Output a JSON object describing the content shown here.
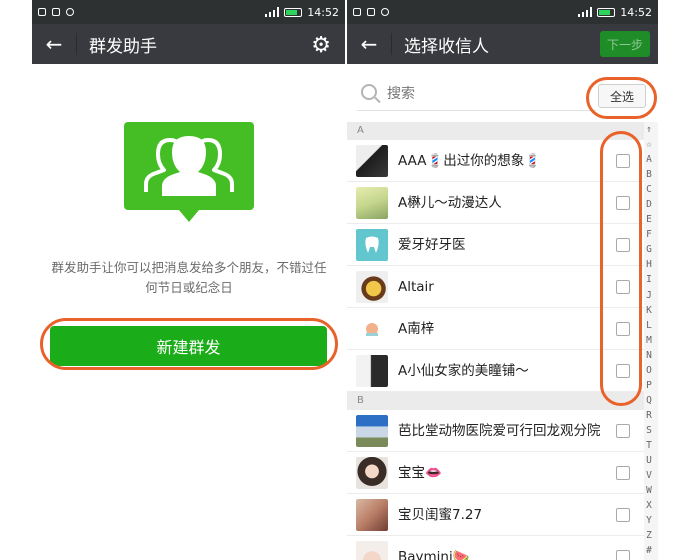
{
  "status_bar": {
    "time": "14:52"
  },
  "left": {
    "title": "群发助手",
    "description": "群发助手让你可以把消息发给多个朋友，不错过任何节日或纪念日",
    "new_broadcast_label": "新建群发",
    "icons": {
      "back": "back-arrow-icon",
      "settings": "gear-icon",
      "group": "group-chat-icon"
    },
    "colors": {
      "bubble": "#45be26",
      "button": "#1aad19",
      "highlight": "#e8622a"
    }
  },
  "right": {
    "title": "选择收信人",
    "next_label": "下一步",
    "search_placeholder": "搜索",
    "select_all_label": "全选",
    "sections": [
      {
        "letter": "A",
        "contacts": [
          {
            "name": "AAA💈出过你的想象💈",
            "checked": false
          },
          {
            "name": "A楙儿～动漫达人",
            "checked": false
          },
          {
            "name": "爱牙好牙医",
            "checked": false
          },
          {
            "name": "Altair",
            "checked": false
          },
          {
            "name": "A南梓",
            "checked": false
          },
          {
            "name": "A小仙女家的美瞳铺～",
            "checked": false
          }
        ]
      },
      {
        "letter": "B",
        "contacts": [
          {
            "name": "芭比堂动物医院爱可行回龙观分院",
            "checked": false
          },
          {
            "name": "宝宝👄",
            "checked": false
          },
          {
            "name": "宝贝闺蜜7.27",
            "checked": false
          },
          {
            "name": "Baymini🍉",
            "checked": false
          }
        ]
      }
    ],
    "index_letters": [
      "↑",
      "☆",
      "A",
      "B",
      "C",
      "D",
      "E",
      "F",
      "G",
      "H",
      "I",
      "J",
      "K",
      "L",
      "M",
      "N",
      "O",
      "P",
      "Q",
      "R",
      "S",
      "T",
      "U",
      "V",
      "W",
      "X",
      "Y",
      "Z",
      "#"
    ]
  }
}
